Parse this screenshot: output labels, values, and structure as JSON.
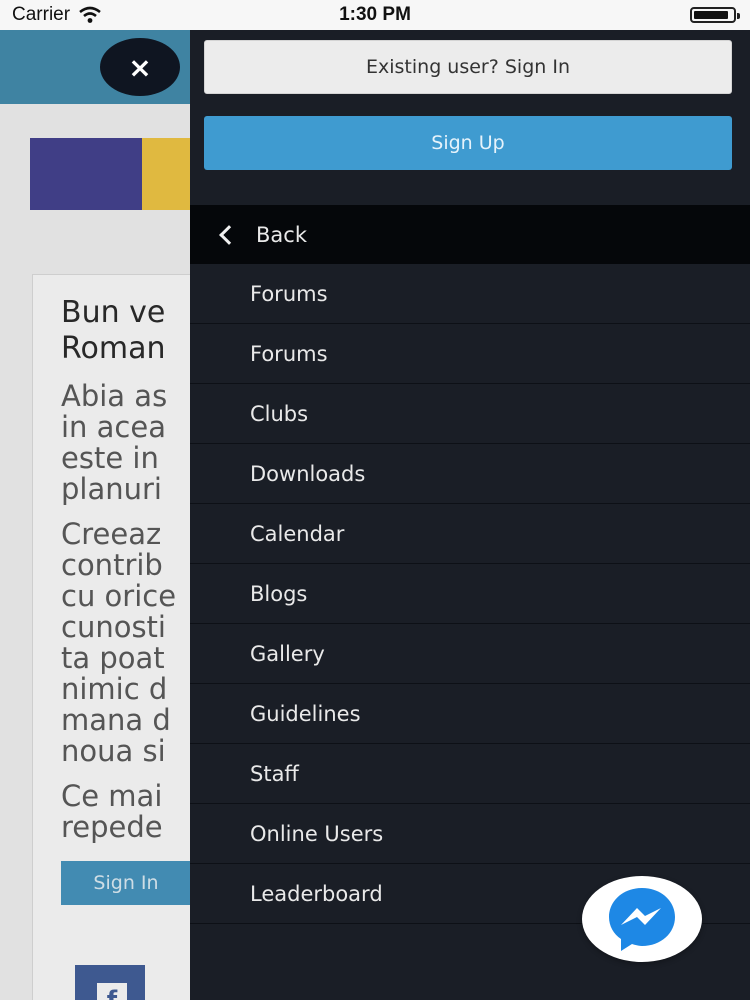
{
  "status_bar": {
    "carrier": "Carrier",
    "time": "1:30 PM",
    "battery_level": 0.9
  },
  "background_page": {
    "close_icon": "close-icon",
    "close_glyph": "×",
    "welcome_lines": "Bun ve\nRoman",
    "paragraph_1": "Abia as\nin acea\neste in\nplanuri",
    "paragraph_2": "Creeaz\ncontrib\ncu orice\ncunosti\nta poat\nnimic d\nmana d\nnoua si",
    "paragraph_3": "Ce mai\nrepede",
    "sign_in_label": "Sign In",
    "facebook_glyph": "f",
    "colors": {
      "header": "#3c89ac",
      "logo_primary": "#3d3b8c",
      "logo_accent": "#f3c73d"
    }
  },
  "drawer": {
    "existing_user_label": "Existing user? Sign In",
    "sign_up_label": "Sign Up",
    "back_label": "Back",
    "items": [
      {
        "label": "Forums"
      },
      {
        "label": "Forums"
      },
      {
        "label": "Clubs"
      },
      {
        "label": "Downloads"
      },
      {
        "label": "Calendar"
      },
      {
        "label": "Blogs"
      },
      {
        "label": "Gallery"
      },
      {
        "label": "Guidelines"
      },
      {
        "label": "Staff"
      },
      {
        "label": "Online Users"
      },
      {
        "label": "Leaderboard"
      }
    ],
    "colors": {
      "background": "#1a1e26",
      "accent": "#3f9bd0"
    }
  },
  "messenger": {
    "icon": "messenger-icon"
  }
}
